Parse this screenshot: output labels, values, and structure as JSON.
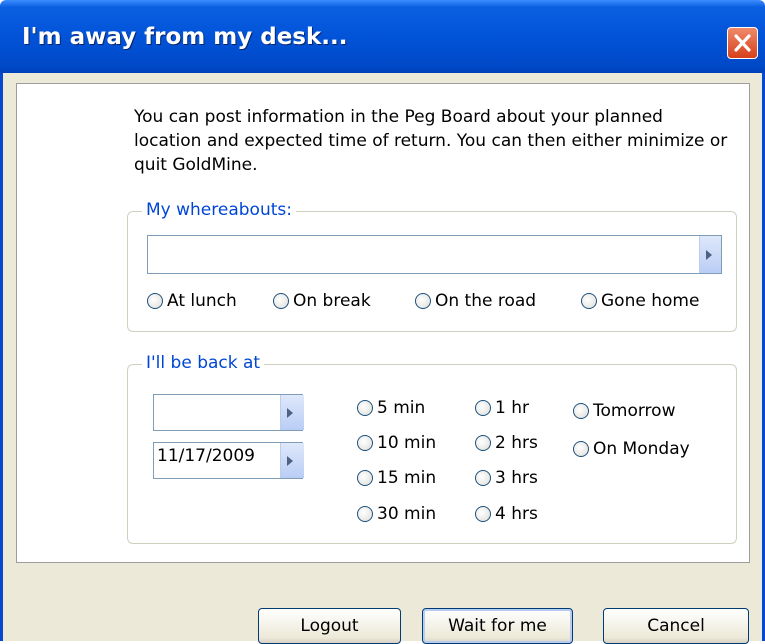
{
  "window": {
    "title": "I'm away from my desk..."
  },
  "intro": {
    "text": "You can post information in the Peg Board about your planned location and expected time of return. You can then either minimize or quit GoldMine."
  },
  "whereabouts": {
    "legend": "My whereabouts:",
    "value": "",
    "options": [
      "At lunch",
      "On break",
      "On the road",
      "Gone home"
    ]
  },
  "back": {
    "legend": "I'll be back at",
    "time_value": "",
    "date_value": "11/17/2009",
    "minutes": [
      "5 min",
      "10 min",
      "15 min",
      "30 min"
    ],
    "hours": [
      "1 hr",
      "2 hrs",
      "3 hrs",
      "4 hrs"
    ],
    "days": [
      "Tomorrow",
      "On Monday"
    ]
  },
  "buttons": {
    "logout": "Logout",
    "wait": "Wait for me",
    "cancel": "Cancel"
  },
  "icons": {
    "close": "close-icon",
    "dropdown": "chevron-right-icon"
  },
  "colors": {
    "titlebar": "#0253d8",
    "legend": "#0046d5",
    "dialog_bg": "#ece9d8",
    "close_button": "#d6401a"
  }
}
